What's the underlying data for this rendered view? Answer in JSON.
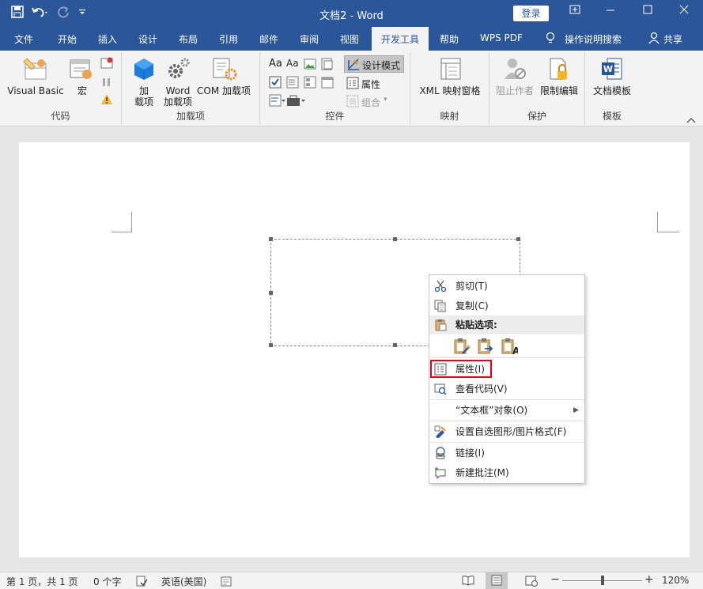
{
  "window": {
    "title": "文档2 - Word",
    "login_label": "登录",
    "controls": [
      "ribbon-display-icon",
      "minimize-icon",
      "maximize-icon",
      "close-icon"
    ]
  },
  "tabs": [
    {
      "label": "文件"
    },
    {
      "label": "开始"
    },
    {
      "label": "插入"
    },
    {
      "label": "设计"
    },
    {
      "label": "布局"
    },
    {
      "label": "引用"
    },
    {
      "label": "邮件"
    },
    {
      "label": "审阅"
    },
    {
      "label": "视图"
    },
    {
      "label": "开发工具",
      "active": true
    },
    {
      "label": "帮助"
    },
    {
      "label": "WPS PDF"
    },
    {
      "label": "操作说明搜索"
    },
    {
      "label": "共享"
    }
  ],
  "ribbon": {
    "code": {
      "label": "代码",
      "visual_basic": "Visual Basic",
      "macro": "宏"
    },
    "addins": {
      "label": "加载项",
      "addin_line1": "加",
      "addin_line2": "载项",
      "word_line1": "Word",
      "word_line2": "加载项",
      "com": "COM 加载项"
    },
    "controls": {
      "label": "控件",
      "design_mode": "设计模式",
      "properties": "属性",
      "group": "组合"
    },
    "mapping": {
      "label": "映射",
      "xml": "XML 映射窗格"
    },
    "protect": {
      "label": "保护",
      "block_authors": "阻止作者",
      "restrict": "限制编辑"
    },
    "templates": {
      "label": "模板",
      "doc_template": "文档模板"
    }
  },
  "context_menu": {
    "cut": "剪切(T)",
    "copy": "复制(C)",
    "paste_options": "粘贴选项:",
    "properties": "属性(I)",
    "view_code": "查看代码(V)",
    "textbox_object": "“文本框”对象(O)",
    "format_shape": "设置自选图形/图片格式(F)",
    "link": "链接(I)",
    "new_comment": "新建批注(M)"
  },
  "status": {
    "page": "第 1 页，共 1 页",
    "words": "0 个字",
    "language": "英语(美国)",
    "zoom": "120%",
    "zoom_level_fraction": 0.6
  },
  "colors": {
    "accent": "#2b579a",
    "highlight": "#e0001b"
  }
}
